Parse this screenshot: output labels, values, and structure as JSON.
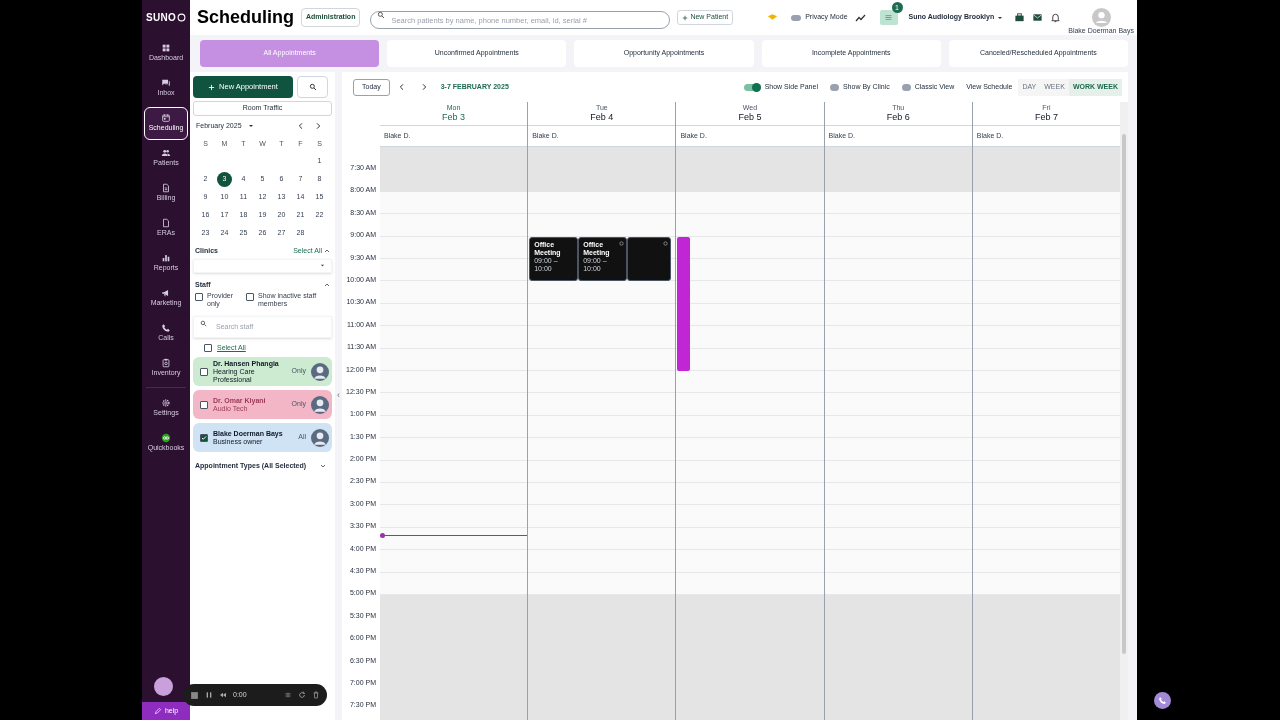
{
  "nav": {
    "logo": "SUNO",
    "items": [
      {
        "label": "Dashboard",
        "selected": false
      },
      {
        "label": "Inbox",
        "selected": false
      },
      {
        "label": "Scheduling",
        "selected": true
      },
      {
        "label": "Patients",
        "selected": false
      },
      {
        "label": "Billing",
        "selected": false
      },
      {
        "label": "ERAs",
        "selected": false
      },
      {
        "label": "Reports",
        "selected": false
      },
      {
        "label": "Marketing",
        "selected": false
      },
      {
        "label": "Calls",
        "selected": false
      },
      {
        "label": "Inventory",
        "selected": false
      },
      {
        "label": "Settings",
        "selected": false
      },
      {
        "label": "Quickbooks",
        "selected": false
      }
    ],
    "help": "help"
  },
  "header": {
    "title": "Scheduling",
    "admin_button": "Administration",
    "search": {
      "placeholder": "Search patients by name, phone number, email, id, serial #"
    },
    "new_patient": "New Patient",
    "privacy_mode": {
      "label": "Privacy Mode",
      "on": false
    },
    "tasks_badge": "1",
    "clinic": "Suno Audiology Brooklyn",
    "user": "Blake Doerman Bays"
  },
  "tabs": [
    {
      "label": "All Appointments",
      "selected": true
    },
    {
      "label": "Unconfirmed Appointments",
      "selected": false
    },
    {
      "label": "Opportunity Appointments",
      "selected": false
    },
    {
      "label": "Incomplete Appointments",
      "selected": false
    },
    {
      "label": "Canceled/Rescheduled Appointments",
      "selected": false
    }
  ],
  "side_panel": {
    "new_appointment": "New Appointment",
    "room_traffic": "Room Traffic",
    "mini_calendar": {
      "month": "February 2025",
      "weekdays": [
        "S",
        "M",
        "T",
        "W",
        "T",
        "F",
        "S"
      ],
      "weeks": [
        [
          {
            "label": "1",
            "selected": false
          }
        ],
        [
          {
            "label": "2",
            "selected": false
          },
          {
            "label": "3",
            "selected": true
          },
          {
            "label": "4",
            "selected": false
          },
          {
            "label": "5",
            "selected": false
          },
          {
            "label": "6",
            "selected": false
          },
          {
            "label": "7",
            "selected": false
          },
          {
            "label": "8",
            "selected": false
          }
        ],
        [
          {
            "label": "9",
            "selected": false
          },
          {
            "label": "10",
            "selected": false
          },
          {
            "label": "11",
            "selected": false
          },
          {
            "label": "12",
            "selected": false
          },
          {
            "label": "13",
            "selected": false
          },
          {
            "label": "14",
            "selected": false
          },
          {
            "label": "15",
            "selected": false
          }
        ],
        [
          {
            "label": "16",
            "selected": false
          },
          {
            "label": "17",
            "selected": false
          },
          {
            "label": "18",
            "selected": false
          },
          {
            "label": "19",
            "selected": false
          },
          {
            "label": "20",
            "selected": false
          },
          {
            "label": "21",
            "selected": false
          },
          {
            "label": "22",
            "selected": false
          }
        ],
        [
          {
            "label": "23",
            "selected": false
          },
          {
            "label": "24",
            "selected": false
          },
          {
            "label": "25",
            "selected": false
          },
          {
            "label": "26",
            "selected": false
          },
          {
            "label": "27",
            "selected": false
          },
          {
            "label": "28",
            "selected": false
          }
        ]
      ]
    },
    "clinics": {
      "label": "Clinics",
      "select_all": "Select All"
    },
    "staff": {
      "label": "Staff",
      "filters": [
        {
          "label": "Provider only",
          "checked": false
        },
        {
          "label": "Show inactive staff members",
          "checked": false
        }
      ],
      "search": {
        "placeholder": "Search staff"
      },
      "select_all": {
        "label": "Select All",
        "checked": false
      },
      "members": [
        {
          "name": "Dr. Hansen Phangia",
          "role": "Hearing Care Professional",
          "scope": "Only",
          "checked": false,
          "inactive": false,
          "color": "#cdebd0"
        },
        {
          "name": "Dr. Omar Kiyani",
          "role": "Audio Tech",
          "scope": "Only",
          "checked": false,
          "inactive": true,
          "color": "#f3b6c6"
        },
        {
          "name": "Blake Doerman Bays",
          "role": "Business owner",
          "scope": "All",
          "checked": true,
          "inactive": false,
          "color": "#cfe3f5"
        }
      ]
    },
    "appointment_types": "Appointment Types (All Selected)",
    "collapse": "‹"
  },
  "calendar": {
    "today_button": "Today",
    "range": "3-7 FEBRUARY 2025",
    "toggles": [
      {
        "label": "Show Side Panel",
        "on": true
      },
      {
        "label": "Show By Clinic",
        "on": false
      },
      {
        "label": "Classic View",
        "on": false
      }
    ],
    "view_schedule": "View Schedule",
    "views": [
      {
        "label": "DAY",
        "selected": false
      },
      {
        "label": "WEEK",
        "selected": false
      },
      {
        "label": "WORK WEEK",
        "selected": true
      }
    ],
    "days": [
      {
        "weekday": "Mon",
        "date": "Feb 3",
        "today": true,
        "staff": "Blake D."
      },
      {
        "weekday": "Tue",
        "date": "Feb 4",
        "today": false,
        "staff": "Blake D.",
        "events": [
          {
            "kind": "meeting",
            "title": "Office Meeting",
            "time": "09:00 – 10:00"
          },
          {
            "kind": "meeting",
            "title": "Office Meeting",
            "time": "09:00 – 10:00"
          },
          {
            "kind": "meeting"
          }
        ]
      },
      {
        "weekday": "Wed",
        "date": "Feb 5",
        "today": false,
        "staff": "Blake D.",
        "events": [
          {
            "kind": "block",
            "color": "#c026d3"
          }
        ]
      },
      {
        "weekday": "Thu",
        "date": "Feb 6",
        "today": false,
        "staff": "Blake D."
      },
      {
        "weekday": "Fri",
        "date": "Feb 7",
        "today": false,
        "staff": "Blake D."
      }
    ],
    "time_labels": [
      "7:30 AM",
      "8:00 AM",
      "8:30 AM",
      "9:00 AM",
      "9:30 AM",
      "10:00 AM",
      "10:30 AM",
      "11:00 AM",
      "11:30 AM",
      "12:00 PM",
      "12:30 PM",
      "1:00 PM",
      "1:30 PM",
      "2:00 PM",
      "2:30 PM",
      "3:00 PM",
      "3:30 PM",
      "4:00 PM",
      "4:30 PM",
      "5:00 PM",
      "5:30 PM",
      "6:00 PM",
      "6:30 PM",
      "7:00 PM",
      "7:30 PM"
    ]
  },
  "recorder": {
    "time": "0:00"
  }
}
